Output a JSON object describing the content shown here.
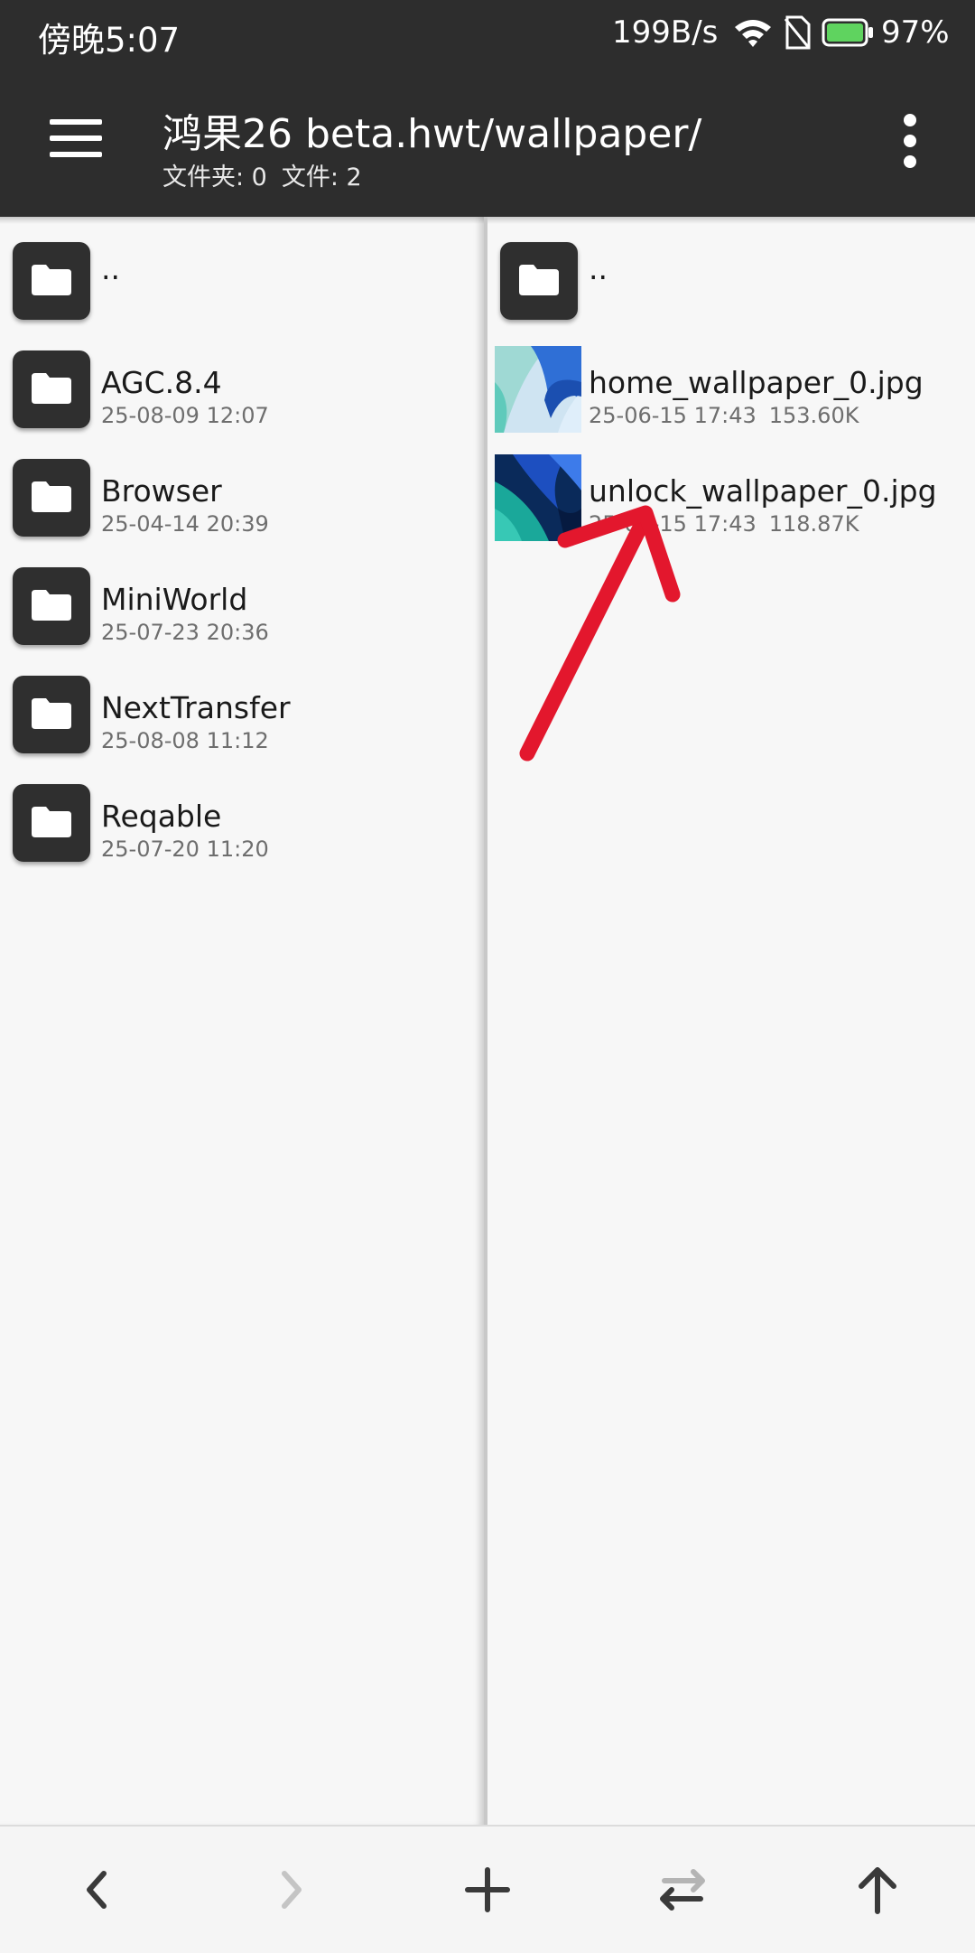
{
  "status_bar": {
    "time": "傍晚5:07",
    "net_speed": "199B/s",
    "battery_percent": "97%",
    "icons": [
      "wifi-icon",
      "no-sim-icon",
      "battery-icon"
    ]
  },
  "header": {
    "title": "鸿果26 beta.hwt/wallpaper/",
    "folders_count": "文件夹: 0",
    "files_count": "文件: 2",
    "icons": [
      "hamburger-menu-icon",
      "more-vert-icon"
    ]
  },
  "left_pane": {
    "parent": "..",
    "items": [
      {
        "name": "AGC.8.4",
        "date": "25-08-09 12:07"
      },
      {
        "name": "Browser",
        "date": "25-04-14 20:39"
      },
      {
        "name": "MiniWorld",
        "date": "25-07-23 20:36"
      },
      {
        "name": "NextTransfer",
        "date": "25-08-08 11:12"
      },
      {
        "name": "Reqable",
        "date": "25-07-20 11:20"
      }
    ]
  },
  "right_pane": {
    "parent": "..",
    "files": [
      {
        "name": "home_wallpaper_0.jpg",
        "date": "25-06-15 17:43",
        "size": "153.60K"
      },
      {
        "name": "unlock_wallpaper_0.jpg",
        "date": "25-06-15 17:43",
        "size": "118.87K"
      }
    ]
  },
  "annotation": {
    "color": "#e3172d",
    "icon": "red-arrow-annotation"
  },
  "toolbar": {
    "icons": [
      "back-icon",
      "forward-icon",
      "add-icon",
      "swap-icon",
      "up-icon"
    ]
  }
}
